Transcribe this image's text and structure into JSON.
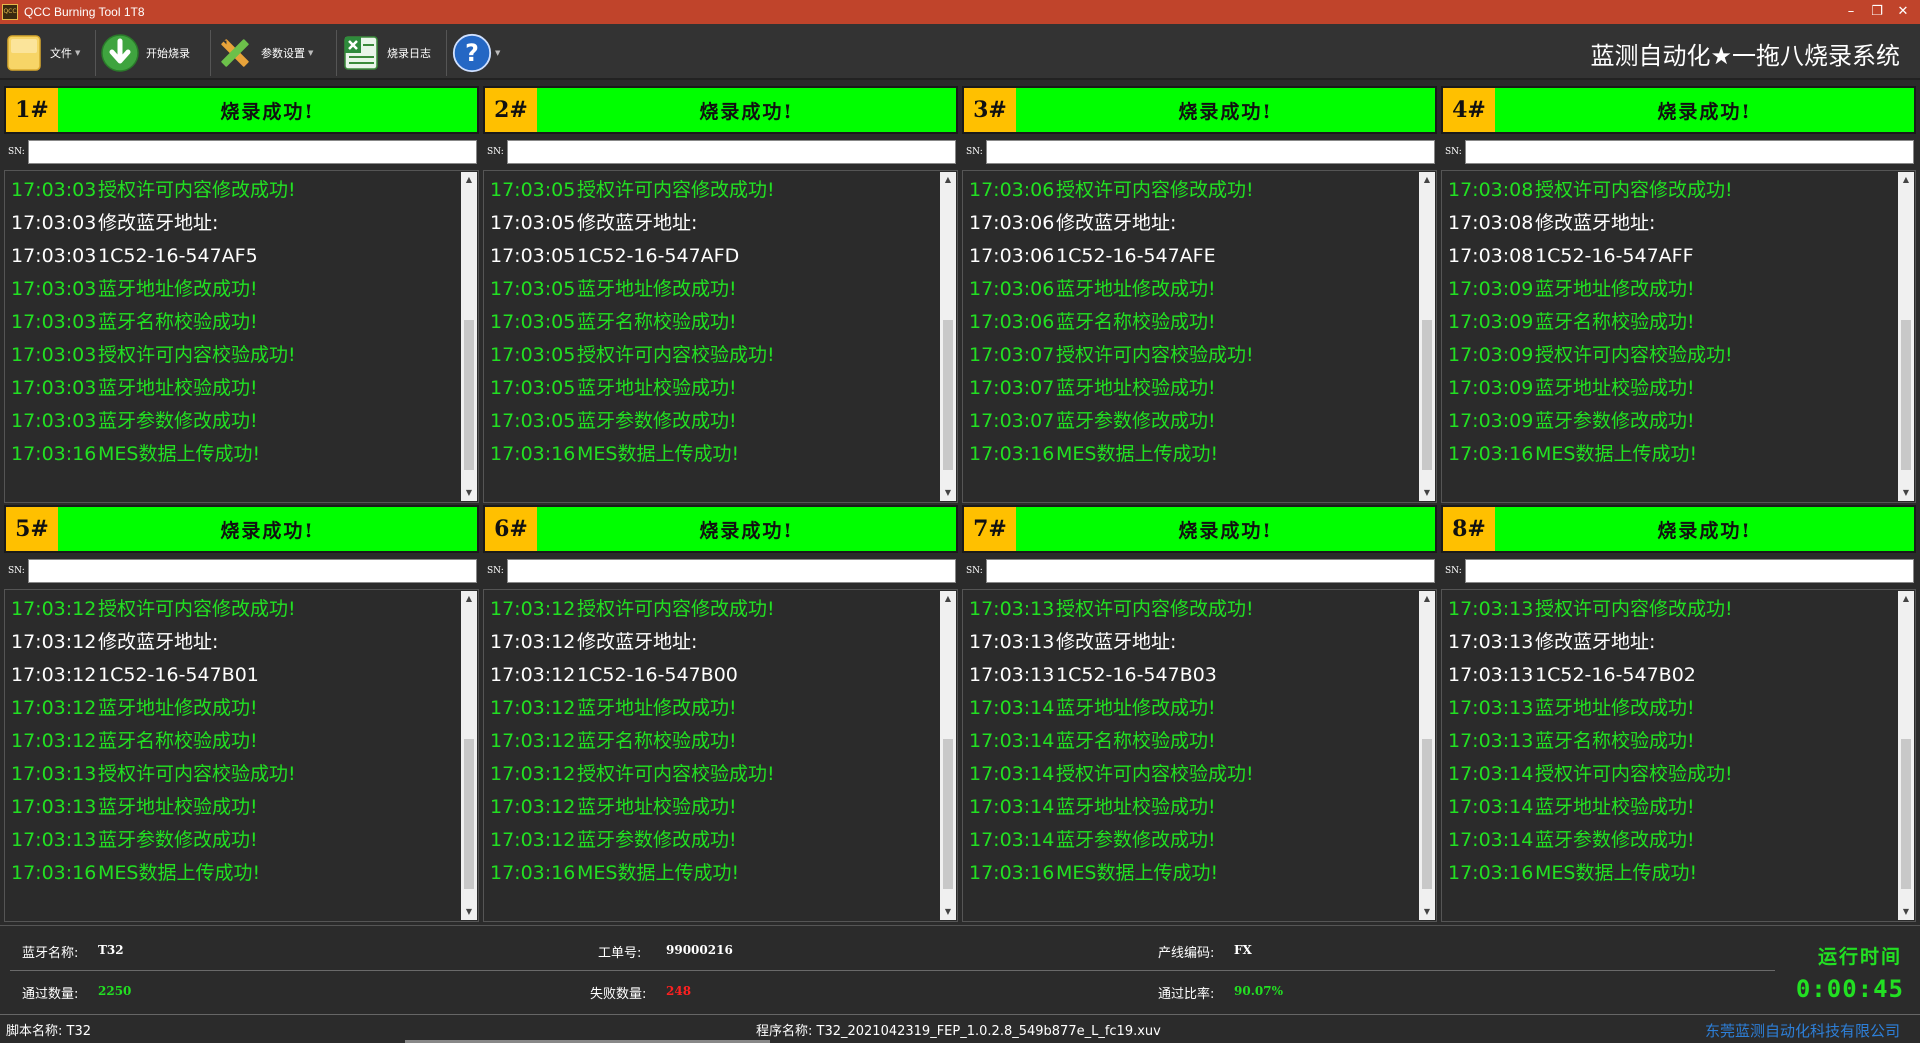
{
  "window": {
    "title": "QCC Burning Tool 1T8",
    "app_icon_text": "QCC",
    "minimize": "–",
    "maximize": "❐",
    "close": "✕"
  },
  "toolbar": {
    "file_label": "文件",
    "start_label": "开始烧录",
    "params_label": "参数设置",
    "log_label": "烧录日志",
    "help_icon_text": "?",
    "brand": "蓝测自动化★一拖八烧录系统"
  },
  "colors": {
    "success_green": "#00ff00",
    "log_green": "#22e022",
    "number_badge": "#ffc000",
    "fail_red": "#ff2020",
    "company_blue": "#2d7fd8"
  },
  "sn_label": "SN:",
  "stations": [
    {
      "num": "1#",
      "status": "烧录成功!",
      "logs": [
        {
          "t": "17:03:03",
          "m": "授权许可内容修改成功!",
          "c": "green"
        },
        {
          "t": "17:03:03",
          "m": "修改蓝牙地址:",
          "c": "white"
        },
        {
          "t": "17:03:03",
          "m": "1C52-16-547AF5",
          "c": "white"
        },
        {
          "t": "17:03:03",
          "m": "蓝牙地址修改成功!",
          "c": "green"
        },
        {
          "t": "17:03:03",
          "m": "蓝牙名称校验成功!",
          "c": "green"
        },
        {
          "t": "17:03:03",
          "m": "授权许可内容校验成功!",
          "c": "green"
        },
        {
          "t": "17:03:03",
          "m": "蓝牙地址校验成功!",
          "c": "green"
        },
        {
          "t": "17:03:03",
          "m": "蓝牙参数修改成功!",
          "c": "green"
        },
        {
          "t": "17:03:16",
          "m": "MES数据上传成功!",
          "c": "green"
        }
      ]
    },
    {
      "num": "2#",
      "status": "烧录成功!",
      "logs": [
        {
          "t": "17:03:05",
          "m": "授权许可内容修改成功!",
          "c": "green"
        },
        {
          "t": "17:03:05",
          "m": "修改蓝牙地址:",
          "c": "white"
        },
        {
          "t": "17:03:05",
          "m": "1C52-16-547AFD",
          "c": "white"
        },
        {
          "t": "17:03:05",
          "m": "蓝牙地址修改成功!",
          "c": "green"
        },
        {
          "t": "17:03:05",
          "m": "蓝牙名称校验成功!",
          "c": "green"
        },
        {
          "t": "17:03:05",
          "m": "授权许可内容校验成功!",
          "c": "green"
        },
        {
          "t": "17:03:05",
          "m": "蓝牙地址校验成功!",
          "c": "green"
        },
        {
          "t": "17:03:05",
          "m": "蓝牙参数修改成功!",
          "c": "green"
        },
        {
          "t": "17:03:16",
          "m": "MES数据上传成功!",
          "c": "green"
        }
      ]
    },
    {
      "num": "3#",
      "status": "烧录成功!",
      "logs": [
        {
          "t": "17:03:06",
          "m": "授权许可内容修改成功!",
          "c": "green"
        },
        {
          "t": "17:03:06",
          "m": "修改蓝牙地址:",
          "c": "white"
        },
        {
          "t": "17:03:06",
          "m": "1C52-16-547AFE",
          "c": "white"
        },
        {
          "t": "17:03:06",
          "m": "蓝牙地址修改成功!",
          "c": "green"
        },
        {
          "t": "17:03:06",
          "m": "蓝牙名称校验成功!",
          "c": "green"
        },
        {
          "t": "17:03:07",
          "m": "授权许可内容校验成功!",
          "c": "green"
        },
        {
          "t": "17:03:07",
          "m": "蓝牙地址校验成功!",
          "c": "green"
        },
        {
          "t": "17:03:07",
          "m": "蓝牙参数修改成功!",
          "c": "green"
        },
        {
          "t": "17:03:16",
          "m": "MES数据上传成功!",
          "c": "green"
        }
      ]
    },
    {
      "num": "4#",
      "status": "烧录成功!",
      "logs": [
        {
          "t": "17:03:08",
          "m": "授权许可内容修改成功!",
          "c": "green"
        },
        {
          "t": "17:03:08",
          "m": "修改蓝牙地址:",
          "c": "white"
        },
        {
          "t": "17:03:08",
          "m": "1C52-16-547AFF",
          "c": "white"
        },
        {
          "t": "17:03:09",
          "m": "蓝牙地址修改成功!",
          "c": "green"
        },
        {
          "t": "17:03:09",
          "m": "蓝牙名称校验成功!",
          "c": "green"
        },
        {
          "t": "17:03:09",
          "m": "授权许可内容校验成功!",
          "c": "green"
        },
        {
          "t": "17:03:09",
          "m": "蓝牙地址校验成功!",
          "c": "green"
        },
        {
          "t": "17:03:09",
          "m": "蓝牙参数修改成功!",
          "c": "green"
        },
        {
          "t": "17:03:16",
          "m": "MES数据上传成功!",
          "c": "green"
        }
      ]
    },
    {
      "num": "5#",
      "status": "烧录成功!",
      "logs": [
        {
          "t": "17:03:12",
          "m": "授权许可内容修改成功!",
          "c": "green"
        },
        {
          "t": "17:03:12",
          "m": "修改蓝牙地址:",
          "c": "white"
        },
        {
          "t": "17:03:12",
          "m": "1C52-16-547B01",
          "c": "white"
        },
        {
          "t": "17:03:12",
          "m": "蓝牙地址修改成功!",
          "c": "green"
        },
        {
          "t": "17:03:12",
          "m": "蓝牙名称校验成功!",
          "c": "green"
        },
        {
          "t": "17:03:13",
          "m": "授权许可内容校验成功!",
          "c": "green"
        },
        {
          "t": "17:03:13",
          "m": "蓝牙地址校验成功!",
          "c": "green"
        },
        {
          "t": "17:03:13",
          "m": "蓝牙参数修改成功!",
          "c": "green"
        },
        {
          "t": "17:03:16",
          "m": "MES数据上传成功!",
          "c": "green"
        }
      ]
    },
    {
      "num": "6#",
      "status": "烧录成功!",
      "logs": [
        {
          "t": "17:03:12",
          "m": "授权许可内容修改成功!",
          "c": "green"
        },
        {
          "t": "17:03:12",
          "m": "修改蓝牙地址:",
          "c": "white"
        },
        {
          "t": "17:03:12",
          "m": "1C52-16-547B00",
          "c": "white"
        },
        {
          "t": "17:03:12",
          "m": "蓝牙地址修改成功!",
          "c": "green"
        },
        {
          "t": "17:03:12",
          "m": "蓝牙名称校验成功!",
          "c": "green"
        },
        {
          "t": "17:03:12",
          "m": "授权许可内容校验成功!",
          "c": "green"
        },
        {
          "t": "17:03:12",
          "m": "蓝牙地址校验成功!",
          "c": "green"
        },
        {
          "t": "17:03:12",
          "m": "蓝牙参数修改成功!",
          "c": "green"
        },
        {
          "t": "17:03:16",
          "m": "MES数据上传成功!",
          "c": "green"
        }
      ]
    },
    {
      "num": "7#",
      "status": "烧录成功!",
      "logs": [
        {
          "t": "17:03:13",
          "m": "授权许可内容修改成功!",
          "c": "green"
        },
        {
          "t": "17:03:13",
          "m": "修改蓝牙地址:",
          "c": "white"
        },
        {
          "t": "17:03:13",
          "m": "1C52-16-547B03",
          "c": "white"
        },
        {
          "t": "17:03:14",
          "m": "蓝牙地址修改成功!",
          "c": "green"
        },
        {
          "t": "17:03:14",
          "m": "蓝牙名称校验成功!",
          "c": "green"
        },
        {
          "t": "17:03:14",
          "m": "授权许可内容校验成功!",
          "c": "green"
        },
        {
          "t": "17:03:14",
          "m": "蓝牙地址校验成功!",
          "c": "green"
        },
        {
          "t": "17:03:14",
          "m": "蓝牙参数修改成功!",
          "c": "green"
        },
        {
          "t": "17:03:16",
          "m": "MES数据上传成功!",
          "c": "green"
        }
      ]
    },
    {
      "num": "8#",
      "status": "烧录成功!",
      "logs": [
        {
          "t": "17:03:13",
          "m": "授权许可内容修改成功!",
          "c": "green"
        },
        {
          "t": "17:03:13",
          "m": "修改蓝牙地址:",
          "c": "white"
        },
        {
          "t": "17:03:13",
          "m": "1C52-16-547B02",
          "c": "white"
        },
        {
          "t": "17:03:13",
          "m": "蓝牙地址修改成功!",
          "c": "green"
        },
        {
          "t": "17:03:13",
          "m": "蓝牙名称校验成功!",
          "c": "green"
        },
        {
          "t": "17:03:14",
          "m": "授权许可内容校验成功!",
          "c": "green"
        },
        {
          "t": "17:03:14",
          "m": "蓝牙地址校验成功!",
          "c": "green"
        },
        {
          "t": "17:03:14",
          "m": "蓝牙参数修改成功!",
          "c": "green"
        },
        {
          "t": "17:03:16",
          "m": "MES数据上传成功!",
          "c": "green"
        }
      ]
    }
  ],
  "info": {
    "bt_name_label": "蓝牙名称:",
    "bt_name_value": "T32",
    "order_label": "工单号:",
    "order_value": "99000216",
    "line_label": "产线编码:",
    "line_value": "FX",
    "pass_count_label": "通过数量:",
    "pass_count_value": "2250",
    "fail_count_label": "失败数量:",
    "fail_count_value": "248",
    "pass_rate_label": "通过比率:",
    "pass_rate_value": "90.07%",
    "runtime_label": "运行时间",
    "runtime_value": "0:00:45"
  },
  "statusbar": {
    "script": "脚本名称: T32",
    "program": "程序名称: T32_2021042319_FEP_1.0.2.8_549b877e_L_fc19.xuv",
    "company": "东莞蓝测自动化科技有限公司"
  }
}
